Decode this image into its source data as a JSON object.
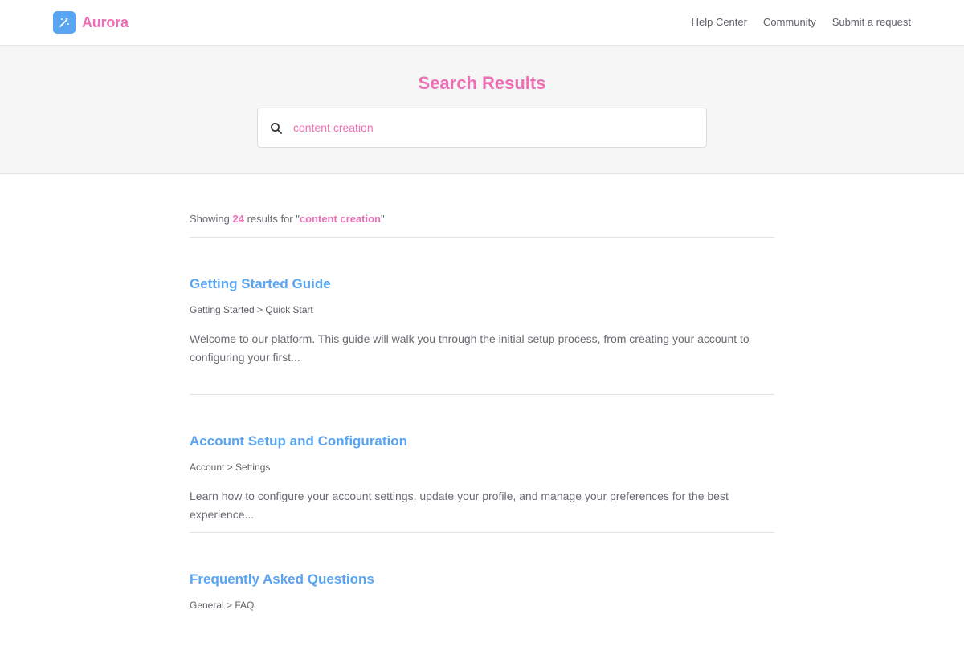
{
  "header": {
    "brand_name": "Aurora",
    "brand_icon": "magic-wand-icon",
    "nav": [
      "Help Center",
      "Community",
      "Submit a request"
    ]
  },
  "hero": {
    "title": "Search Results",
    "search_icon": "search-icon",
    "search_value": "content creation"
  },
  "summary": {
    "prefix": "Showing ",
    "count": "24",
    "middle": " results for \"",
    "query": "content creation",
    "suffix": "\""
  },
  "results": [
    {
      "title": "Getting Started Guide",
      "path": "Getting Started > Quick Start",
      "excerpt": "Welcome to our platform. This guide will walk you through the initial setup process, from creating your account to configuring your first..."
    },
    {
      "title": "Account Setup and Configuration",
      "path": "Account > Settings",
      "excerpt": "Learn how to configure your account settings, update your profile, and manage your preferences for the best experience..."
    },
    {
      "title": "Frequently Asked Questions",
      "path": "General > FAQ",
      "excerpt": ""
    }
  ],
  "colors": {
    "brand_pink": "#ee6fb6",
    "link_blue": "#5aa5f2",
    "logo_blue": "#5aa5f2"
  }
}
